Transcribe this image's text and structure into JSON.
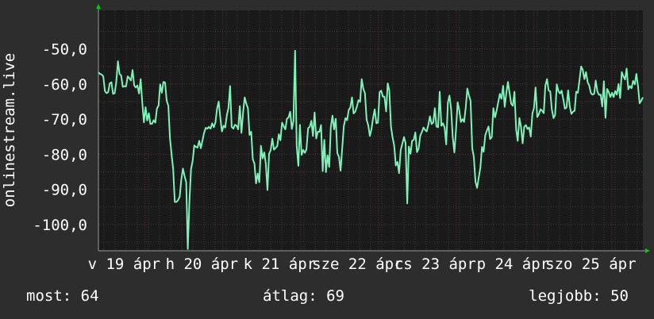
{
  "chart_data": {
    "type": "line",
    "ylabel": "onlinestream.live",
    "ylim": [
      -107.5,
      -39
    ],
    "y_ticks": [
      -50,
      -60,
      -70,
      -80,
      -90,
      -100
    ],
    "y_tick_labels": [
      "-50,0",
      "-60,0",
      "-70,0",
      "-80,0",
      "-90,0",
      "-100,0"
    ],
    "x_tick_labels": [
      "v 19 ápr",
      "h 20 ápr",
      "k 21 ápr",
      "sze 22 ápr",
      "cs 23 ápr",
      "p 24 ápr",
      "szo 25 ápr"
    ],
    "grid": true,
    "colors": {
      "line": "#7ff2b8",
      "background": "#2d2d2d",
      "plot": "#1a1a1a",
      "grid_major": "#5a3232",
      "grid_minor": "#3a3a3a",
      "arrow": "#00cc00"
    },
    "series": [
      {
        "values": [
          -56.7,
          -57.1,
          -57.3,
          -57.8,
          -62.0,
          -62.6,
          -62.3,
          -59.8,
          -59.5,
          -62.8,
          -62.6,
          -59.4,
          -53.5,
          -57.1,
          -57.6,
          -60.8,
          -60.6,
          -60.7,
          -57.8,
          -58.3,
          -59.0,
          -56.0,
          -60.4,
          -61.0,
          -60.4,
          -62.7,
          -58.6,
          -65.4,
          -70.9,
          -66.6,
          -70.4,
          -68.3,
          -71.4,
          -71.3,
          -70.3,
          -71.0,
          -67.0,
          -66.1,
          -60.1,
          -62.5,
          -59.4,
          -59.6,
          -64.7,
          -66.2,
          -75.3,
          -79.9,
          -84.3,
          -93.6,
          -93.6,
          -93.1,
          -92.1,
          -87.3,
          -84.1,
          -86.2,
          -88.0,
          -107.0,
          -93.3,
          -84.2,
          -81.8,
          -77.5,
          -77.9,
          -78.1,
          -76.2,
          -78.3,
          -76.1,
          -73.9,
          -72.5,
          -72.7,
          -72.2,
          -72.7,
          -71.2,
          -72.3,
          -71.0,
          -67.0,
          -65.0,
          -69.6,
          -73.5,
          -71.9,
          -72.4,
          -68.9,
          -66.9,
          -60.6,
          -72.2,
          -72.7,
          -71.6,
          -71.9,
          -72.9,
          -66.3,
          -73.9,
          -68.0,
          -63.8,
          -65.6,
          -66.9,
          -74.5,
          -73.6,
          -81.4,
          -82.7,
          -88.3,
          -85.5,
          -88.0,
          -77.6,
          -81.2,
          -79.5,
          -82.7,
          -90.2,
          -79.9,
          -78.8,
          -75.6,
          -78.7,
          -78.2,
          -77.7,
          -74.3,
          -76.0,
          -71.0,
          -72.0,
          -72.9,
          -69.9,
          -69.5,
          -67.9,
          -72.8,
          -70.6,
          -50.5,
          -77.6,
          -83.3,
          -71.6,
          -80.2,
          -78.8,
          -79.6,
          -78.6,
          -72.6,
          -72.2,
          -70.5,
          -74.8,
          -68.1,
          -75.5,
          -73.6,
          -73.6,
          -71.7,
          -84.8,
          -75.9,
          -85.1,
          -80.3,
          -83.6,
          -72.3,
          -69.0,
          -72.9,
          -69.9,
          -79.7,
          -80.8,
          -84.7,
          -78.2,
          -72.0,
          -69.7,
          -70.3,
          -67.4,
          -66.7,
          -63.8,
          -68.4,
          -67.9,
          -66.5,
          -64.6,
          -65.1,
          -58.6,
          -61.4,
          -62.6,
          -70.1,
          -71.7,
          -74.8,
          -72.9,
          -69.6,
          -67.2,
          -71.2,
          -71.0,
          -62.3,
          -61.9,
          -63.6,
          -63.6,
          -67.8,
          -59.8,
          -61.8,
          -72.1,
          -75.2,
          -77.6,
          -83.2,
          -82.2,
          -85.4,
          -78.8,
          -77.0,
          -75.1,
          -76.8,
          -94.0,
          -77.8,
          -79.9,
          -76.2,
          -75.9,
          -73.8,
          -79.4,
          -78.4,
          -74.7,
          -73.7,
          -72.4,
          -73.1,
          -73.5,
          -71.6,
          -69.2,
          -71.4,
          -71.0,
          -66.9,
          -72.1,
          -72.3,
          -62.2,
          -71.9,
          -71.2,
          -72.4,
          -77.2,
          -65.3,
          -63.3,
          -67.2,
          -75.1,
          -79.5,
          -73.2,
          -65.2,
          -67.4,
          -70.8,
          -70.0,
          -70.8,
          -66.7,
          -61.3,
          -63.3,
          -64.8,
          -78.3,
          -80.8,
          -87.9,
          -89.6,
          -86.6,
          -83.9,
          -77.9,
          -79.3,
          -74.6,
          -73.3,
          -72.1,
          -75.7,
          -75.1,
          -66.9,
          -69.5,
          -67.6,
          -65.2,
          -62.8,
          -64.2,
          -60.5,
          -66.5,
          -62.5,
          -59.4,
          -62.7,
          -65.6,
          -66.2,
          -62.2,
          -72.9,
          -76.2,
          -69.7,
          -72.1,
          -76.9,
          -72.2,
          -71.7,
          -72.8,
          -72.4,
          -75.0,
          -68.4,
          -66.8,
          -61.0,
          -69.4,
          -68.6,
          -67.2,
          -67.6,
          -68.3,
          -60.5,
          -58.6,
          -61.8,
          -62.1,
          -67.3,
          -69.7,
          -68.8,
          -60.1,
          -62.0,
          -62.7,
          -61.9,
          -64.3,
          -67.0,
          -66.7,
          -61.8,
          -66.4,
          -68.5,
          -67.9,
          -67.6,
          -62.2,
          -62.5,
          -58.9,
          -55.0,
          -55.9,
          -58.6,
          -56.6,
          -59.5,
          -60.4,
          -62.6,
          -63.0,
          -62.8,
          -59.0,
          -62.2,
          -63.1,
          -63.0,
          -66.4,
          -59.2,
          -69.6,
          -61.4,
          -62.3,
          -63.7,
          -62.5,
          -63.7,
          -62.0,
          -63.0,
          -60.0,
          -64.0,
          -56.6,
          -57.8,
          -58.7,
          -55.6,
          -61.5,
          -60.6,
          -61.2,
          -59.1,
          -60.1,
          -57.1,
          -60.7,
          -65.5,
          -64.7,
          -63.8
        ]
      }
    ],
    "stats": {
      "now": "most: 64",
      "avg": "átlag: 69",
      "max": "legjobb: 50"
    }
  }
}
